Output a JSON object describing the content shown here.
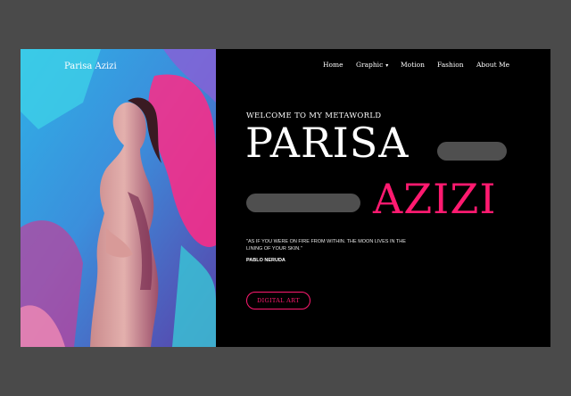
{
  "brand": {
    "name": "Parisa Azizi"
  },
  "nav": {
    "items": [
      {
        "label": "Home"
      },
      {
        "label": "Graphic",
        "caret": "▾"
      },
      {
        "label": "Motion"
      },
      {
        "label": "Fashion"
      },
      {
        "label": "About Me"
      }
    ]
  },
  "hero": {
    "welcome": "WELCOME TO MY METAWORLD",
    "title_first": "PARISA",
    "title_last": "AZIZI",
    "quote": "\"AS IF YOU WERE ON FIRE FROM WITHIN. THE MOON LIVES IN THE LINING OF YOUR SKIN.\"",
    "author": "PABLO NERUDA",
    "cta_label": "DIGITAL ART"
  },
  "colors": {
    "accent": "#ff1a70",
    "background": "#000000",
    "page": "#4a4a4a",
    "pill": "#4f4f4f"
  }
}
